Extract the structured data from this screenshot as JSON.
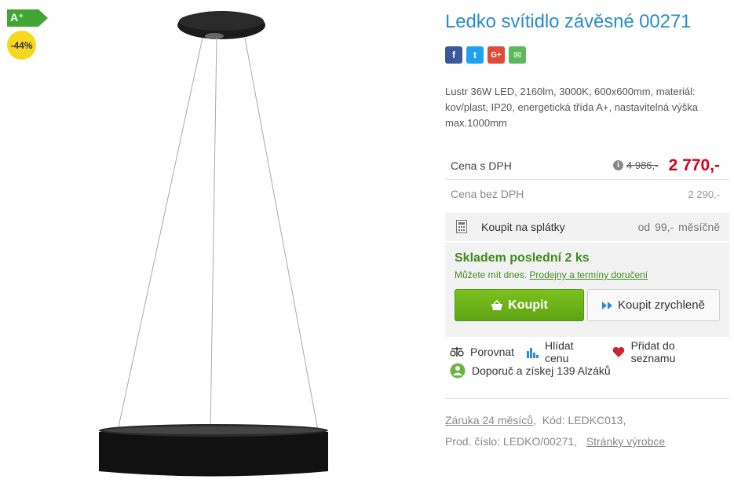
{
  "badges": {
    "energy_class": "A⁺",
    "discount": "-44%"
  },
  "product": {
    "title": "Ledko svítidlo závěsné 00271",
    "description": "Lustr 36W LED, 2160lm, 3000K, 600x600mm, materiál: kov/plast, IP20, energetická třída A+, nastavitelná výška max.1000mm"
  },
  "share": {
    "facebook": "f",
    "twitter": "t",
    "googleplus": "G+",
    "email": "✉"
  },
  "price": {
    "with_vat_label": "Cena s DPH",
    "info_icon": "i",
    "old_price": "4 986,-",
    "new_price": "2 770,-",
    "without_vat_label": "Cena bez DPH",
    "without_vat_value": "2 290,-"
  },
  "installments": {
    "label": "Koupit na splátky",
    "value": "od  99,-  měsíčně"
  },
  "stock": {
    "title": "Skladem poslední 2 ks",
    "subtitle": "Můžete mít dnes.",
    "link": "Prodejny a termíny doručení"
  },
  "buttons": {
    "buy": "Koupit",
    "quick_buy": "Koupit zrychleně"
  },
  "actions": {
    "compare": "Porovnat",
    "watch_price": "Hlídat cenu",
    "add_to_list": "Přidat do seznamu",
    "recommend": "Doporuč a získej 139 Alzáků"
  },
  "meta": {
    "warranty": "Záruka 24 měsíců",
    "code": "Kód: LEDKC013,",
    "product_number": "Prod. číslo: LEDKO/00271,",
    "manufacturer_link": "Stránky výrobce"
  },
  "colors": {
    "title": "#2b8dc9",
    "price_red": "#d0021b",
    "stock_green": "#3f8b1d",
    "energy_green": "#41a535",
    "discount_yellow": "#f5d81f"
  },
  "icons": {
    "energy": "energy-label-arrow",
    "calculator": "calculator-icon",
    "basket": "basket-icon",
    "quick": "double-chevron-icon",
    "compare": "scales-icon",
    "watch": "chart-icon",
    "heart": "heart-icon",
    "recommend": "recommend-icon"
  }
}
